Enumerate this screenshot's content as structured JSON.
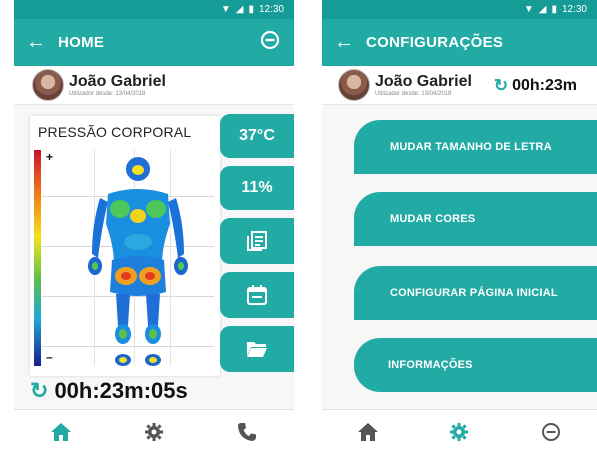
{
  "status": {
    "time": "12:30"
  },
  "left_screen": {
    "title": "HOME",
    "user": {
      "name": "João Gabriel",
      "since": "Utilizador desde: 13/04/2018"
    },
    "pressure": {
      "title": "PRESSÃO CORPORAL",
      "scale_max": "+",
      "scale_min": "–"
    },
    "tiles": {
      "temperature": "37°C",
      "percentage": "11%"
    },
    "timer": "00h:23m:05s"
  },
  "right_screen": {
    "title": "CONFIGURAÇÕES",
    "user": {
      "name": "João Gabriel",
      "since": "Utilizador desde: 13/04/2018"
    },
    "timer": "00h:23m",
    "menu": [
      "MUDAR TAMANHO DE LETRA",
      "MUDAR CORES",
      "CONFIGURAR PÁGINA INICIAL",
      "INFORMAÇÕES"
    ]
  },
  "colors": {
    "primary": "#22aaa4",
    "status_bar": "#169c96"
  }
}
